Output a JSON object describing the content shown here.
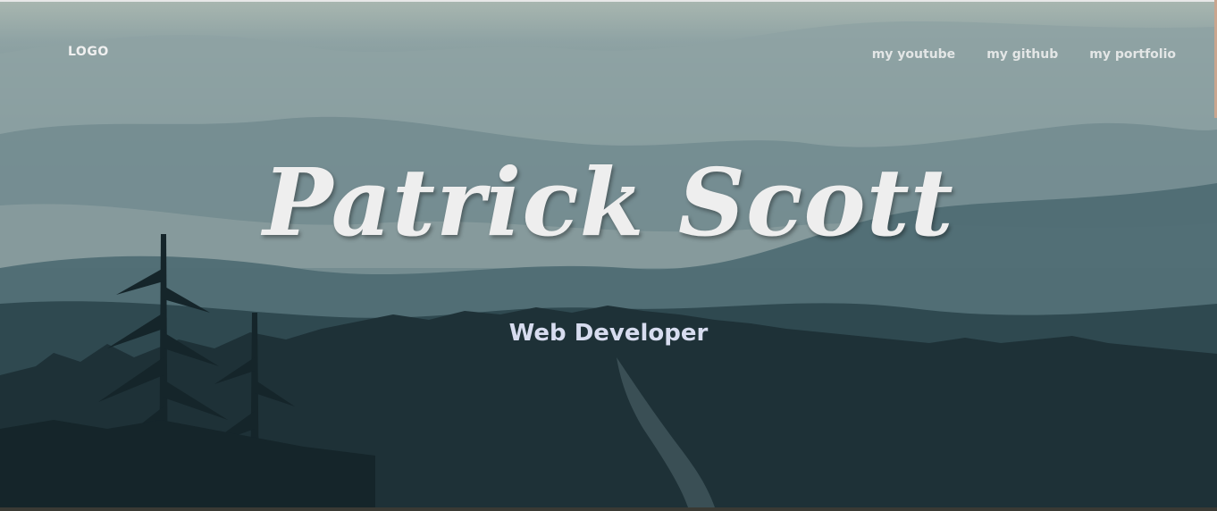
{
  "nav": {
    "logo": "LOGO",
    "links": [
      {
        "label": "my youtube"
      },
      {
        "label": "my github"
      },
      {
        "label": "my portfolio"
      }
    ]
  },
  "hero": {
    "title": "Patrick Scott",
    "subtitle": "Web Developer"
  }
}
